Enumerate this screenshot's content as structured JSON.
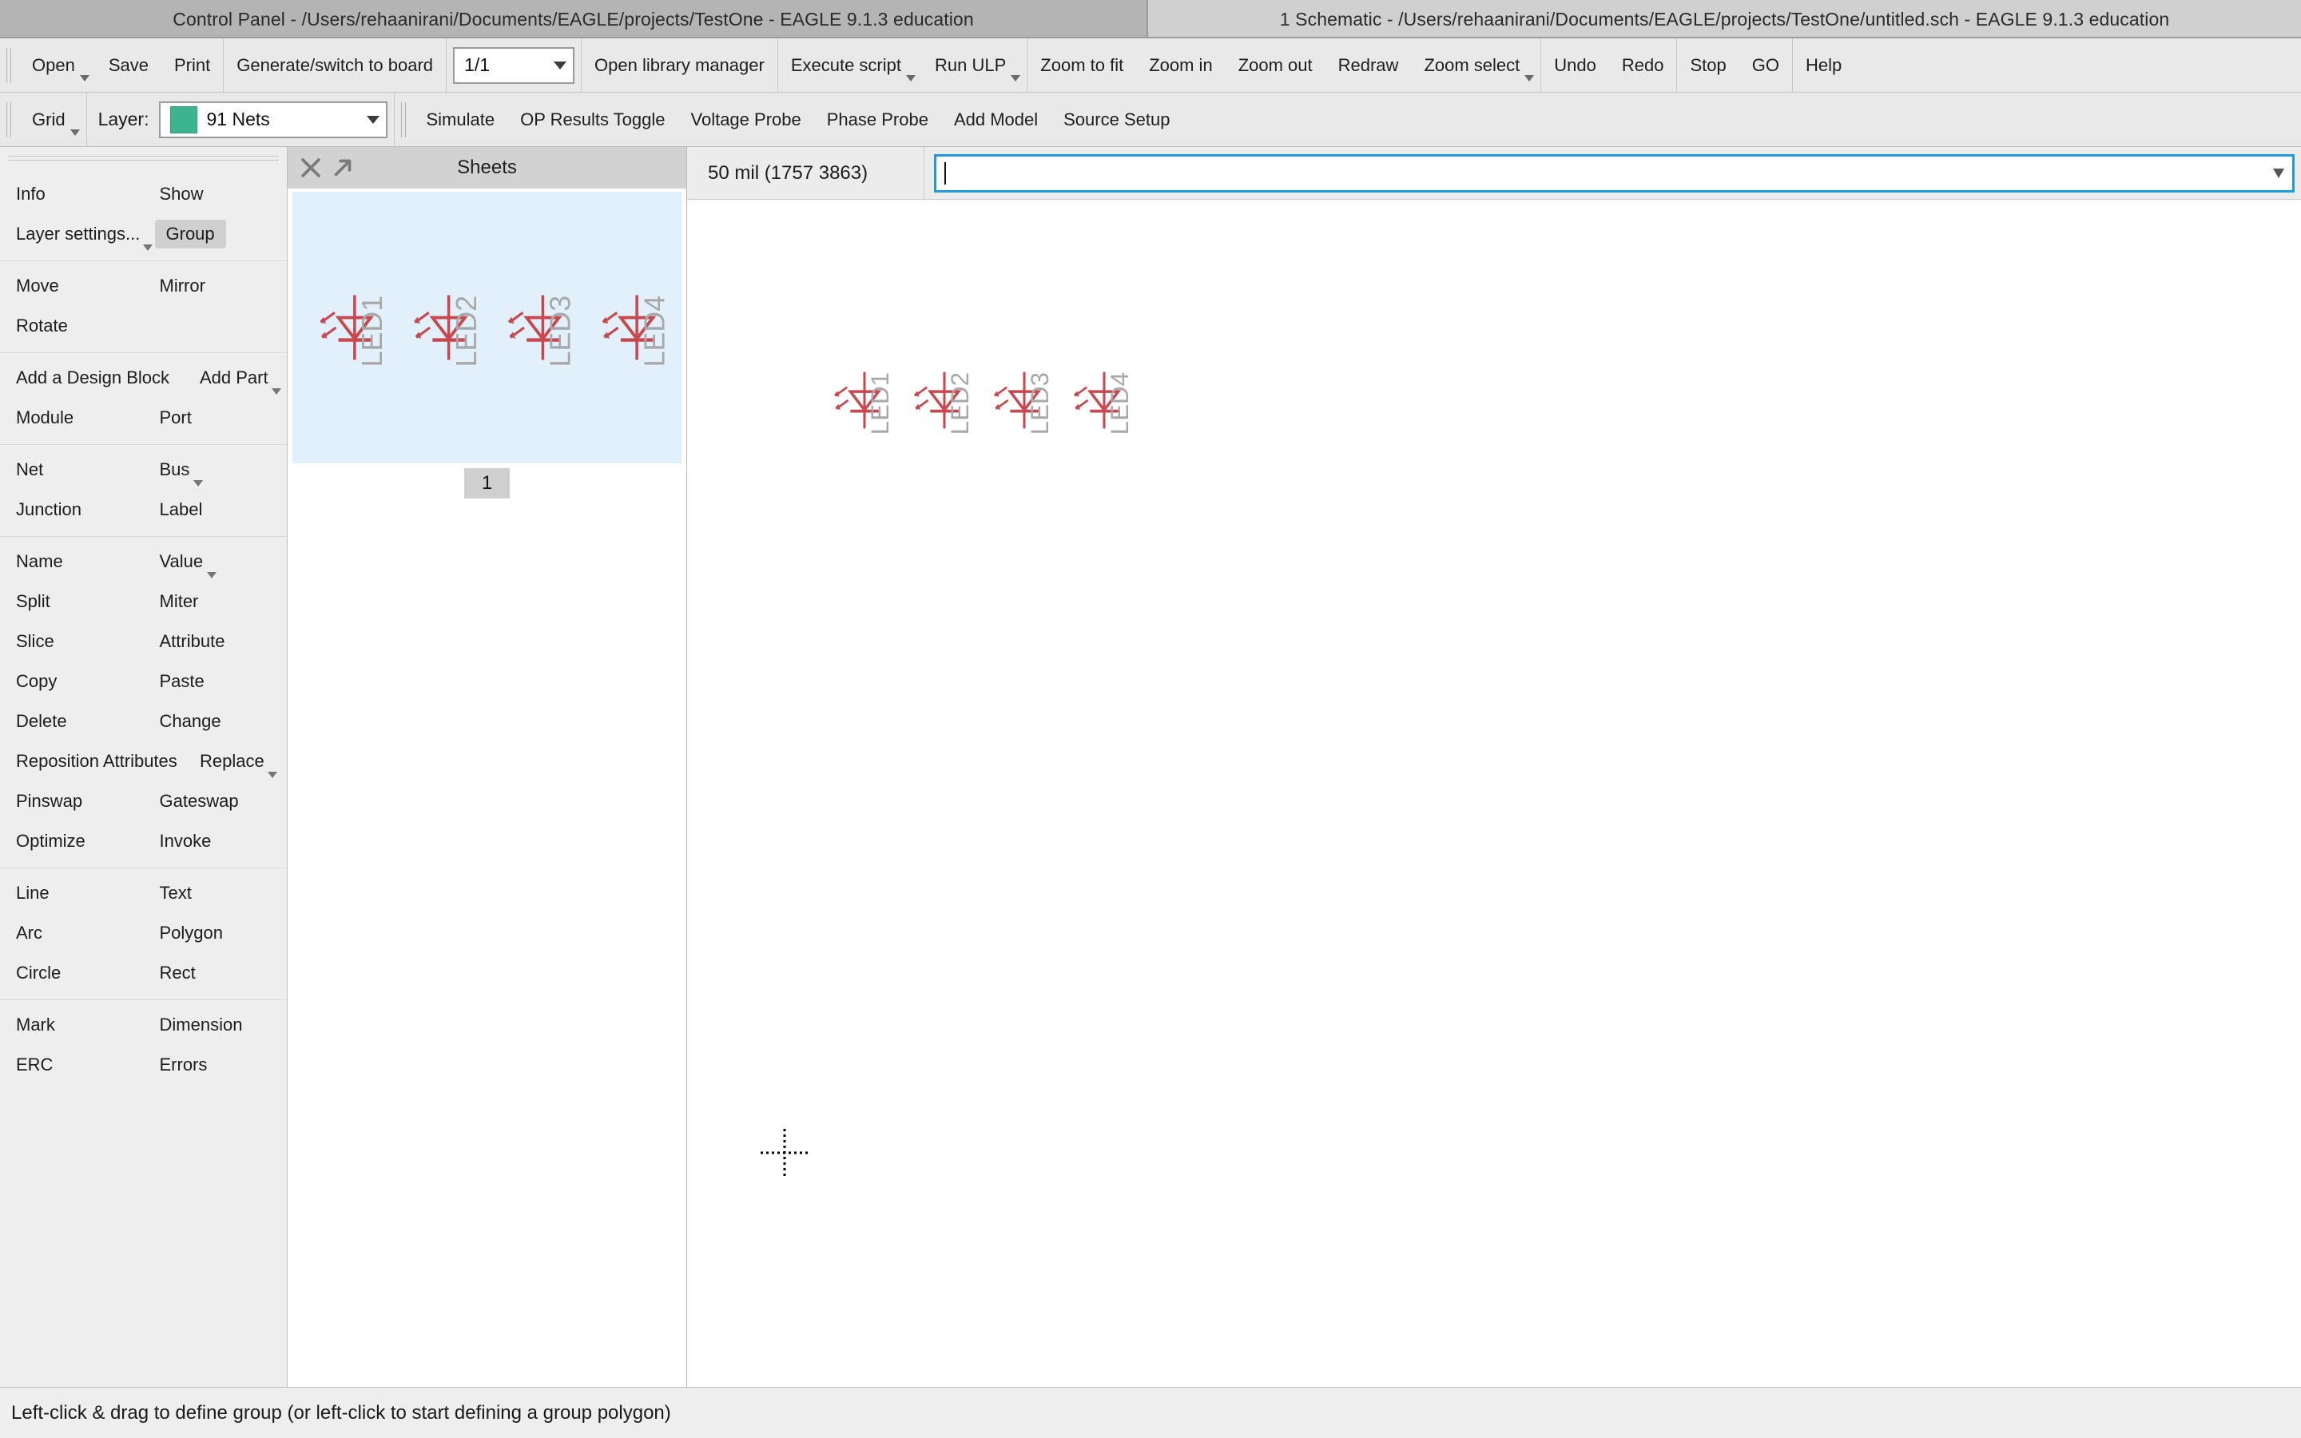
{
  "window": {
    "control_panel_title": "Control Panel - /Users/rehaanirani/Documents/EAGLE/projects/TestOne - EAGLE 9.1.3 education",
    "schematic_title": "1 Schematic - /Users/rehaanirani/Documents/EAGLE/projects/TestOne/untitled.sch - EAGLE 9.1.3 education"
  },
  "toolbar_row1": {
    "groups": [
      {
        "items": [
          {
            "label": "Open",
            "caret": true,
            "name": "open-button"
          },
          {
            "label": "Save",
            "caret": false,
            "name": "save-button"
          },
          {
            "label": "Print",
            "caret": false,
            "name": "print-button"
          }
        ]
      },
      {
        "items": [
          {
            "label": "Generate/switch to board",
            "caret": false,
            "name": "generate-switch-to-board-button"
          }
        ]
      },
      {
        "combo": {
          "value": "1/1",
          "name": "sheet-selector-combo"
        }
      },
      {
        "items": [
          {
            "label": "Open library manager",
            "caret": false,
            "name": "open-library-manager-button"
          }
        ]
      },
      {
        "items": [
          {
            "label": "Execute script",
            "caret": true,
            "name": "execute-script-button"
          },
          {
            "label": "Run ULP",
            "caret": true,
            "name": "run-ulp-button"
          }
        ]
      },
      {
        "items": [
          {
            "label": "Zoom to fit",
            "caret": false,
            "name": "zoom-to-fit-button"
          },
          {
            "label": "Zoom in",
            "caret": false,
            "name": "zoom-in-button"
          },
          {
            "label": "Zoom out",
            "caret": false,
            "name": "zoom-out-button"
          },
          {
            "label": "Redraw",
            "caret": false,
            "name": "redraw-button"
          },
          {
            "label": "Zoom select",
            "caret": true,
            "name": "zoom-select-button"
          }
        ]
      },
      {
        "items": [
          {
            "label": "Undo",
            "caret": false,
            "name": "undo-button"
          },
          {
            "label": "Redo",
            "caret": false,
            "name": "redo-button"
          }
        ]
      },
      {
        "items": [
          {
            "label": "Stop",
            "caret": false,
            "name": "stop-button"
          },
          {
            "label": "GO",
            "caret": false,
            "name": "go-button"
          }
        ]
      },
      {
        "items": [
          {
            "label": "Help",
            "caret": false,
            "name": "help-button"
          }
        ]
      }
    ]
  },
  "toolbar_row2": {
    "grid_label": "Grid",
    "layer_label": "Layer:",
    "layer_value": "91 Nets",
    "layer_color": "#3cb48d",
    "buttons": [
      {
        "label": "Simulate",
        "name": "simulate-button"
      },
      {
        "label": "OP Results Toggle",
        "name": "op-results-toggle-button"
      },
      {
        "label": "Voltage Probe",
        "name": "voltage-probe-button"
      },
      {
        "label": "Phase Probe",
        "name": "phase-probe-button"
      },
      {
        "label": "Add Model",
        "name": "add-model-button"
      },
      {
        "label": "Source Setup",
        "name": "source-setup-button"
      }
    ]
  },
  "tool_palette": {
    "sections": [
      {
        "rows": [
          [
            {
              "label": "Info",
              "name": "tool-info"
            },
            {
              "label": "Show",
              "name": "tool-show"
            }
          ],
          [
            {
              "label": "Layer settings...",
              "name": "tool-layer-settings",
              "caret": true
            },
            {
              "label": "Group",
              "name": "tool-group",
              "active": true
            }
          ]
        ]
      },
      {
        "rows": [
          [
            {
              "label": "Move",
              "name": "tool-move"
            },
            {
              "label": "Mirror",
              "name": "tool-mirror"
            }
          ],
          [
            {
              "label": "Rotate",
              "name": "tool-rotate"
            },
            {
              "label": "",
              "name": "tool-empty-1"
            }
          ]
        ]
      },
      {
        "rows": [
          [
            {
              "label": "Add a Design Block",
              "name": "tool-add-design-block",
              "wide": true
            },
            {
              "label": "Add Part",
              "name": "tool-add-part",
              "caret": true
            }
          ],
          [
            {
              "label": "Module",
              "name": "tool-module"
            },
            {
              "label": "Port",
              "name": "tool-port"
            }
          ]
        ]
      },
      {
        "rows": [
          [
            {
              "label": "Net",
              "name": "tool-net"
            },
            {
              "label": "Bus",
              "name": "tool-bus",
              "caret": true
            }
          ],
          [
            {
              "label": "Junction",
              "name": "tool-junction"
            },
            {
              "label": "Label",
              "name": "tool-label"
            }
          ]
        ]
      },
      {
        "rows": [
          [
            {
              "label": "Name",
              "name": "tool-name"
            },
            {
              "label": "Value",
              "name": "tool-value",
              "caret": true
            }
          ],
          [
            {
              "label": "Split",
              "name": "tool-split"
            },
            {
              "label": "Miter",
              "name": "tool-miter"
            }
          ],
          [
            {
              "label": "Slice",
              "name": "tool-slice"
            },
            {
              "label": "Attribute",
              "name": "tool-attribute"
            }
          ],
          [
            {
              "label": "Copy",
              "name": "tool-copy"
            },
            {
              "label": "Paste",
              "name": "tool-paste"
            }
          ],
          [
            {
              "label": "Delete",
              "name": "tool-delete"
            },
            {
              "label": "Change",
              "name": "tool-change"
            }
          ],
          [
            {
              "label": "Reposition Attributes",
              "name": "tool-reposition-attributes",
              "wide": true
            },
            {
              "label": "Replace",
              "name": "tool-replace",
              "caret": true
            }
          ],
          [
            {
              "label": "Pinswap",
              "name": "tool-pinswap"
            },
            {
              "label": "Gateswap",
              "name": "tool-gateswap"
            }
          ],
          [
            {
              "label": "Optimize",
              "name": "tool-optimize"
            },
            {
              "label": "Invoke",
              "name": "tool-invoke"
            }
          ]
        ]
      },
      {
        "rows": [
          [
            {
              "label": "Line",
              "name": "tool-line"
            },
            {
              "label": "Text",
              "name": "tool-text"
            }
          ],
          [
            {
              "label": "Arc",
              "name": "tool-arc"
            },
            {
              "label": "Polygon",
              "name": "tool-polygon"
            }
          ],
          [
            {
              "label": "Circle",
              "name": "tool-circle"
            },
            {
              "label": "Rect",
              "name": "tool-rect"
            }
          ]
        ]
      },
      {
        "rows": [
          [
            {
              "label": "Mark",
              "name": "tool-mark"
            },
            {
              "label": "Dimension",
              "name": "tool-dimension"
            }
          ],
          [
            {
              "label": "ERC",
              "name": "tool-erc"
            },
            {
              "label": "Errors",
              "name": "tool-errors"
            }
          ]
        ]
      }
    ]
  },
  "sheets_panel": {
    "title": "Sheets",
    "close_icon": "close-icon",
    "undock_icon": "undock-arrow-icon",
    "sheet_tab_label": "1",
    "thumbnail_parts": [
      "LED1",
      "LED2",
      "LED3",
      "LED4"
    ]
  },
  "schematic": {
    "coordinate_readout": "50 mil (1757 3863)",
    "command_value": "",
    "command_placeholder": "",
    "parts": [
      "LED1",
      "LED2",
      "LED3",
      "LED4"
    ],
    "symbol_color": "#c9484e",
    "label_color": "#a8a8a8"
  },
  "status": {
    "message": "Left-click & drag to define group (or left-click to start defining a group polygon)"
  }
}
